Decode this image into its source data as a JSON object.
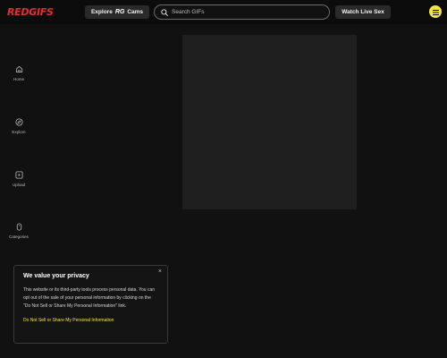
{
  "header": {
    "logo": "REDGIFS",
    "explore_label": "Explore",
    "explore_mark": "RG",
    "explore_suffix": "Cams",
    "search_placeholder": "Search GIFs",
    "live_label": "Watch Live Sex",
    "menu_icon": "hamburger-menu-icon"
  },
  "sidebar": {
    "items": [
      {
        "label": "Home",
        "icon": "home-icon"
      },
      {
        "label": "Explore",
        "icon": "compass-icon"
      },
      {
        "label": "Upload",
        "icon": "upload-icon"
      },
      {
        "label": "Categories",
        "icon": "mouse-icon"
      }
    ]
  },
  "privacy": {
    "title": "We value your privacy",
    "body": "This website or its third-party tools process personal data. You can opt out of the sale of your personal information by clicking on the \"Do Not Sell or Share My Personal Information\" link.",
    "link": "Do Not Sell or Share My Personal Information",
    "close": "×"
  },
  "colors": {
    "brand": "#e52e2e",
    "accent": "#f3e34b",
    "background": "#111111"
  }
}
